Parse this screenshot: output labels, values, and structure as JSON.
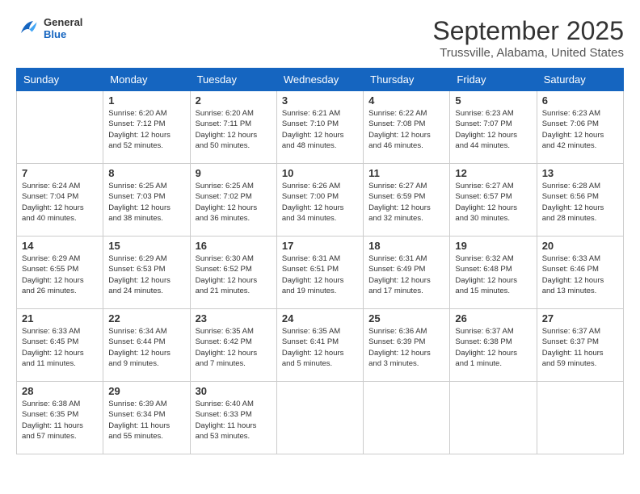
{
  "header": {
    "logo": {
      "general": "General",
      "blue": "Blue"
    },
    "month": "September 2025",
    "location": "Trussville, Alabama, United States"
  },
  "weekdays": [
    "Sunday",
    "Monday",
    "Tuesday",
    "Wednesday",
    "Thursday",
    "Friday",
    "Saturday"
  ],
  "weeks": [
    [
      {
        "day": "",
        "info": ""
      },
      {
        "day": "1",
        "info": "Sunrise: 6:20 AM\nSunset: 7:12 PM\nDaylight: 12 hours\nand 52 minutes."
      },
      {
        "day": "2",
        "info": "Sunrise: 6:20 AM\nSunset: 7:11 PM\nDaylight: 12 hours\nand 50 minutes."
      },
      {
        "day": "3",
        "info": "Sunrise: 6:21 AM\nSunset: 7:10 PM\nDaylight: 12 hours\nand 48 minutes."
      },
      {
        "day": "4",
        "info": "Sunrise: 6:22 AM\nSunset: 7:08 PM\nDaylight: 12 hours\nand 46 minutes."
      },
      {
        "day": "5",
        "info": "Sunrise: 6:23 AM\nSunset: 7:07 PM\nDaylight: 12 hours\nand 44 minutes."
      },
      {
        "day": "6",
        "info": "Sunrise: 6:23 AM\nSunset: 7:06 PM\nDaylight: 12 hours\nand 42 minutes."
      }
    ],
    [
      {
        "day": "7",
        "info": "Sunrise: 6:24 AM\nSunset: 7:04 PM\nDaylight: 12 hours\nand 40 minutes."
      },
      {
        "day": "8",
        "info": "Sunrise: 6:25 AM\nSunset: 7:03 PM\nDaylight: 12 hours\nand 38 minutes."
      },
      {
        "day": "9",
        "info": "Sunrise: 6:25 AM\nSunset: 7:02 PM\nDaylight: 12 hours\nand 36 minutes."
      },
      {
        "day": "10",
        "info": "Sunrise: 6:26 AM\nSunset: 7:00 PM\nDaylight: 12 hours\nand 34 minutes."
      },
      {
        "day": "11",
        "info": "Sunrise: 6:27 AM\nSunset: 6:59 PM\nDaylight: 12 hours\nand 32 minutes."
      },
      {
        "day": "12",
        "info": "Sunrise: 6:27 AM\nSunset: 6:57 PM\nDaylight: 12 hours\nand 30 minutes."
      },
      {
        "day": "13",
        "info": "Sunrise: 6:28 AM\nSunset: 6:56 PM\nDaylight: 12 hours\nand 28 minutes."
      }
    ],
    [
      {
        "day": "14",
        "info": "Sunrise: 6:29 AM\nSunset: 6:55 PM\nDaylight: 12 hours\nand 26 minutes."
      },
      {
        "day": "15",
        "info": "Sunrise: 6:29 AM\nSunset: 6:53 PM\nDaylight: 12 hours\nand 24 minutes."
      },
      {
        "day": "16",
        "info": "Sunrise: 6:30 AM\nSunset: 6:52 PM\nDaylight: 12 hours\nand 21 minutes."
      },
      {
        "day": "17",
        "info": "Sunrise: 6:31 AM\nSunset: 6:51 PM\nDaylight: 12 hours\nand 19 minutes."
      },
      {
        "day": "18",
        "info": "Sunrise: 6:31 AM\nSunset: 6:49 PM\nDaylight: 12 hours\nand 17 minutes."
      },
      {
        "day": "19",
        "info": "Sunrise: 6:32 AM\nSunset: 6:48 PM\nDaylight: 12 hours\nand 15 minutes."
      },
      {
        "day": "20",
        "info": "Sunrise: 6:33 AM\nSunset: 6:46 PM\nDaylight: 12 hours\nand 13 minutes."
      }
    ],
    [
      {
        "day": "21",
        "info": "Sunrise: 6:33 AM\nSunset: 6:45 PM\nDaylight: 12 hours\nand 11 minutes."
      },
      {
        "day": "22",
        "info": "Sunrise: 6:34 AM\nSunset: 6:44 PM\nDaylight: 12 hours\nand 9 minutes."
      },
      {
        "day": "23",
        "info": "Sunrise: 6:35 AM\nSunset: 6:42 PM\nDaylight: 12 hours\nand 7 minutes."
      },
      {
        "day": "24",
        "info": "Sunrise: 6:35 AM\nSunset: 6:41 PM\nDaylight: 12 hours\nand 5 minutes."
      },
      {
        "day": "25",
        "info": "Sunrise: 6:36 AM\nSunset: 6:39 PM\nDaylight: 12 hours\nand 3 minutes."
      },
      {
        "day": "26",
        "info": "Sunrise: 6:37 AM\nSunset: 6:38 PM\nDaylight: 12 hours\nand 1 minute."
      },
      {
        "day": "27",
        "info": "Sunrise: 6:37 AM\nSunset: 6:37 PM\nDaylight: 11 hours\nand 59 minutes."
      }
    ],
    [
      {
        "day": "28",
        "info": "Sunrise: 6:38 AM\nSunset: 6:35 PM\nDaylight: 11 hours\nand 57 minutes."
      },
      {
        "day": "29",
        "info": "Sunrise: 6:39 AM\nSunset: 6:34 PM\nDaylight: 11 hours\nand 55 minutes."
      },
      {
        "day": "30",
        "info": "Sunrise: 6:40 AM\nSunset: 6:33 PM\nDaylight: 11 hours\nand 53 minutes."
      },
      {
        "day": "",
        "info": ""
      },
      {
        "day": "",
        "info": ""
      },
      {
        "day": "",
        "info": ""
      },
      {
        "day": "",
        "info": ""
      }
    ]
  ]
}
